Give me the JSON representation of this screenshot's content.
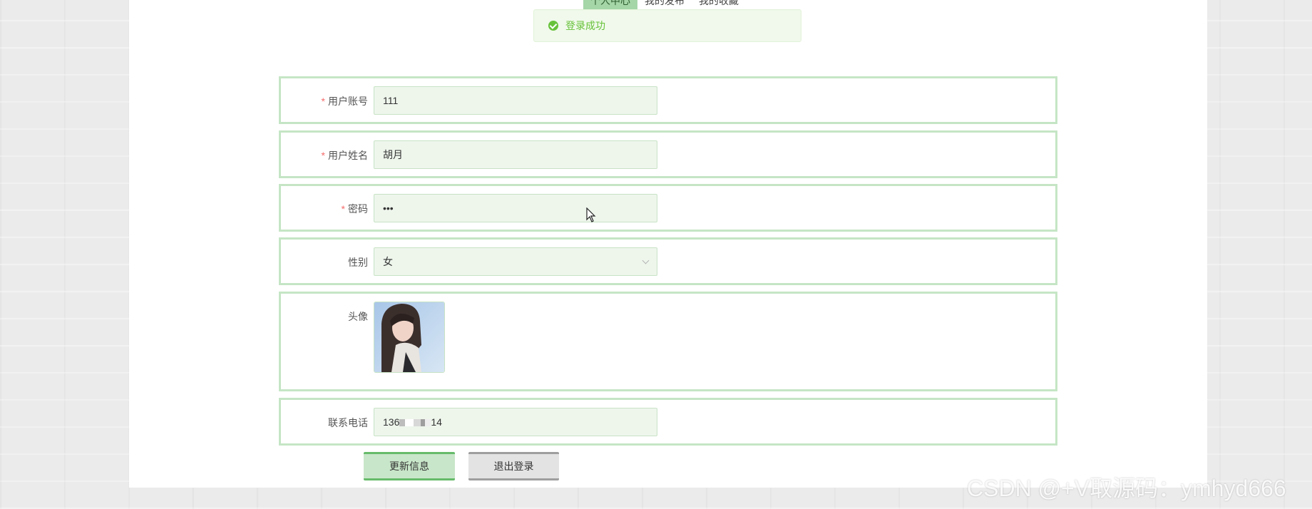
{
  "tabs": [
    {
      "label": "个人中心",
      "active": true
    },
    {
      "label": "我的发布",
      "active": false
    },
    {
      "label": "我的收藏",
      "active": false
    }
  ],
  "toast": {
    "icon": "success-check-icon",
    "message": "登录成功",
    "color": "#67c23a"
  },
  "form": {
    "username": {
      "label": "用户账号",
      "required": true,
      "value": "111"
    },
    "realname": {
      "label": "用户姓名",
      "required": true,
      "value": "胡月"
    },
    "password": {
      "label": "密码",
      "required": true,
      "value": "•••"
    },
    "gender": {
      "label": "性别",
      "required": false,
      "value": "女"
    },
    "avatar": {
      "label": "头像",
      "required": false
    },
    "phone": {
      "label": "联系电话",
      "required": false,
      "value_prefix": "136",
      "value_suffix": "14"
    }
  },
  "buttons": {
    "update": "更新信息",
    "logout": "退出登录"
  },
  "watermark": "CSDN @+V取源码：ymhyd666",
  "colors": {
    "accent": "#a5d6a7",
    "border": "#c5e5c5",
    "input_bg": "#eef6ec"
  }
}
